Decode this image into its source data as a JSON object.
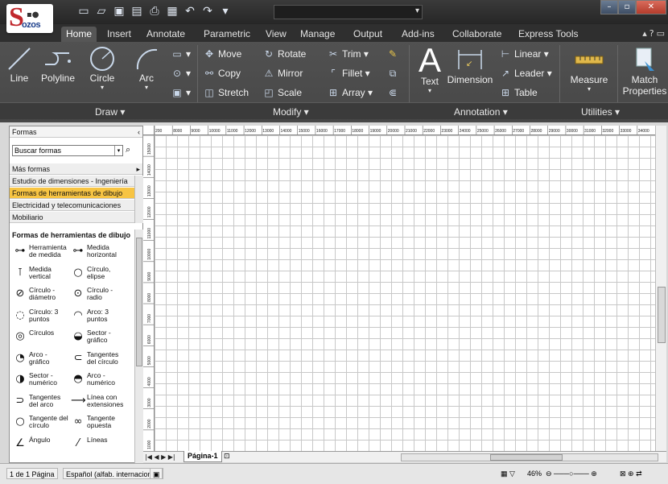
{
  "quick_access": {
    "icons": [
      "new-icon",
      "open-icon",
      "save-icon",
      "save-as-icon",
      "plot-icon",
      "undo-icon",
      "redo-icon"
    ]
  },
  "tabs": [
    {
      "label": "Home",
      "active": true
    },
    {
      "label": "Insert"
    },
    {
      "label": "Annotate"
    },
    {
      "label": "Parametric"
    },
    {
      "label": "View"
    },
    {
      "label": "Manage"
    },
    {
      "label": "Output"
    },
    {
      "label": "Add-ins"
    },
    {
      "label": "Collaborate"
    },
    {
      "label": "Express Tools"
    }
  ],
  "ribbon": {
    "draw": {
      "title": "Draw ▾",
      "line": "Line",
      "polyline": "Polyline",
      "circle": "Circle",
      "arc": "Arc"
    },
    "modify": {
      "title": "Modify ▾",
      "move": "Move",
      "copy": "Copy",
      "stretch": "Stretch",
      "rotate": "Rotate",
      "mirror": "Mirror",
      "scale": "Scale",
      "trim": "Trim ▾",
      "fillet": "Fillet ▾",
      "array": "Array ▾"
    },
    "annotation": {
      "title": "Annotation ▾",
      "text": "Text",
      "dimension": "Dimension",
      "linear": "Linear ▾",
      "leader": "Leader ▾",
      "table": "Table"
    },
    "utilities": {
      "title": "Utilities ▾",
      "measure": "Measure"
    },
    "match_properties": {
      "line1": "Match",
      "line2": "Properties"
    }
  },
  "shapes_panel": {
    "title": "Formas",
    "search_placeholder": "Buscar formas",
    "categories": [
      "Más formas",
      "Estudio de dimensiones - Ingeniería",
      "Formas de herramientas de dibujo",
      "Electricidad y telecomunicaciones",
      "Mobiliario"
    ],
    "stencil_title": "Formas de herramientas de dibujo",
    "shapes": [
      {
        "l1": "Herramienta",
        "l2": "de medida"
      },
      {
        "l1": "Medida",
        "l2": "horizontal"
      },
      {
        "l1": "Medida",
        "l2": "vertical"
      },
      {
        "l1": "Círculo,",
        "l2": "elipse"
      },
      {
        "l1": "Círculo -",
        "l2": "diámetro"
      },
      {
        "l1": "Círculo -",
        "l2": "radio"
      },
      {
        "l1": "Círculo: 3",
        "l2": "puntos"
      },
      {
        "l1": "Arco: 3",
        "l2": "puntos"
      },
      {
        "l1": "Círculos",
        "l2": ""
      },
      {
        "l1": "Sector -",
        "l2": "gráfico"
      },
      {
        "l1": "Arco -",
        "l2": "gráfico"
      },
      {
        "l1": "Tangentes",
        "l2": "del círculo"
      },
      {
        "l1": "Sector -",
        "l2": "numérico"
      },
      {
        "l1": "Arco -",
        "l2": "numérico"
      },
      {
        "l1": "Tangentes",
        "l2": "del arco"
      },
      {
        "l1": "Línea con",
        "l2": "extensiones"
      },
      {
        "l1": "Tangente del",
        "l2": "círculo"
      },
      {
        "l1": "Tangente",
        "l2": "opuesta"
      },
      {
        "l1": "Ángulo",
        "l2": ""
      },
      {
        "l1": "Líneas",
        "l2": ""
      }
    ]
  },
  "rulers": {
    "top": [
      "200",
      "8000",
      "9000",
      "10000",
      "11000",
      "12000",
      "13000",
      "14000",
      "15000",
      "16000",
      "17000",
      "18000",
      "19000",
      "20000",
      "21000",
      "22000",
      "23000",
      "24000",
      "25000",
      "26000",
      "27000",
      "28000",
      "29000",
      "30000",
      "31000",
      "32000",
      "33000",
      "34000"
    ],
    "left": [
      "15000",
      "14000",
      "13000",
      "12000",
      "11000",
      "10000",
      "9000",
      "8000",
      "7000",
      "6000",
      "5000",
      "4000",
      "3000",
      "2000",
      "1000"
    ]
  },
  "page_tabs": {
    "nav": "|◀ ◀ ▶ ▶|",
    "current": "Página-1"
  },
  "status": {
    "page": "1 de 1 Página",
    "language": "Español (alfab. internacional)",
    "zoom": "46%"
  }
}
